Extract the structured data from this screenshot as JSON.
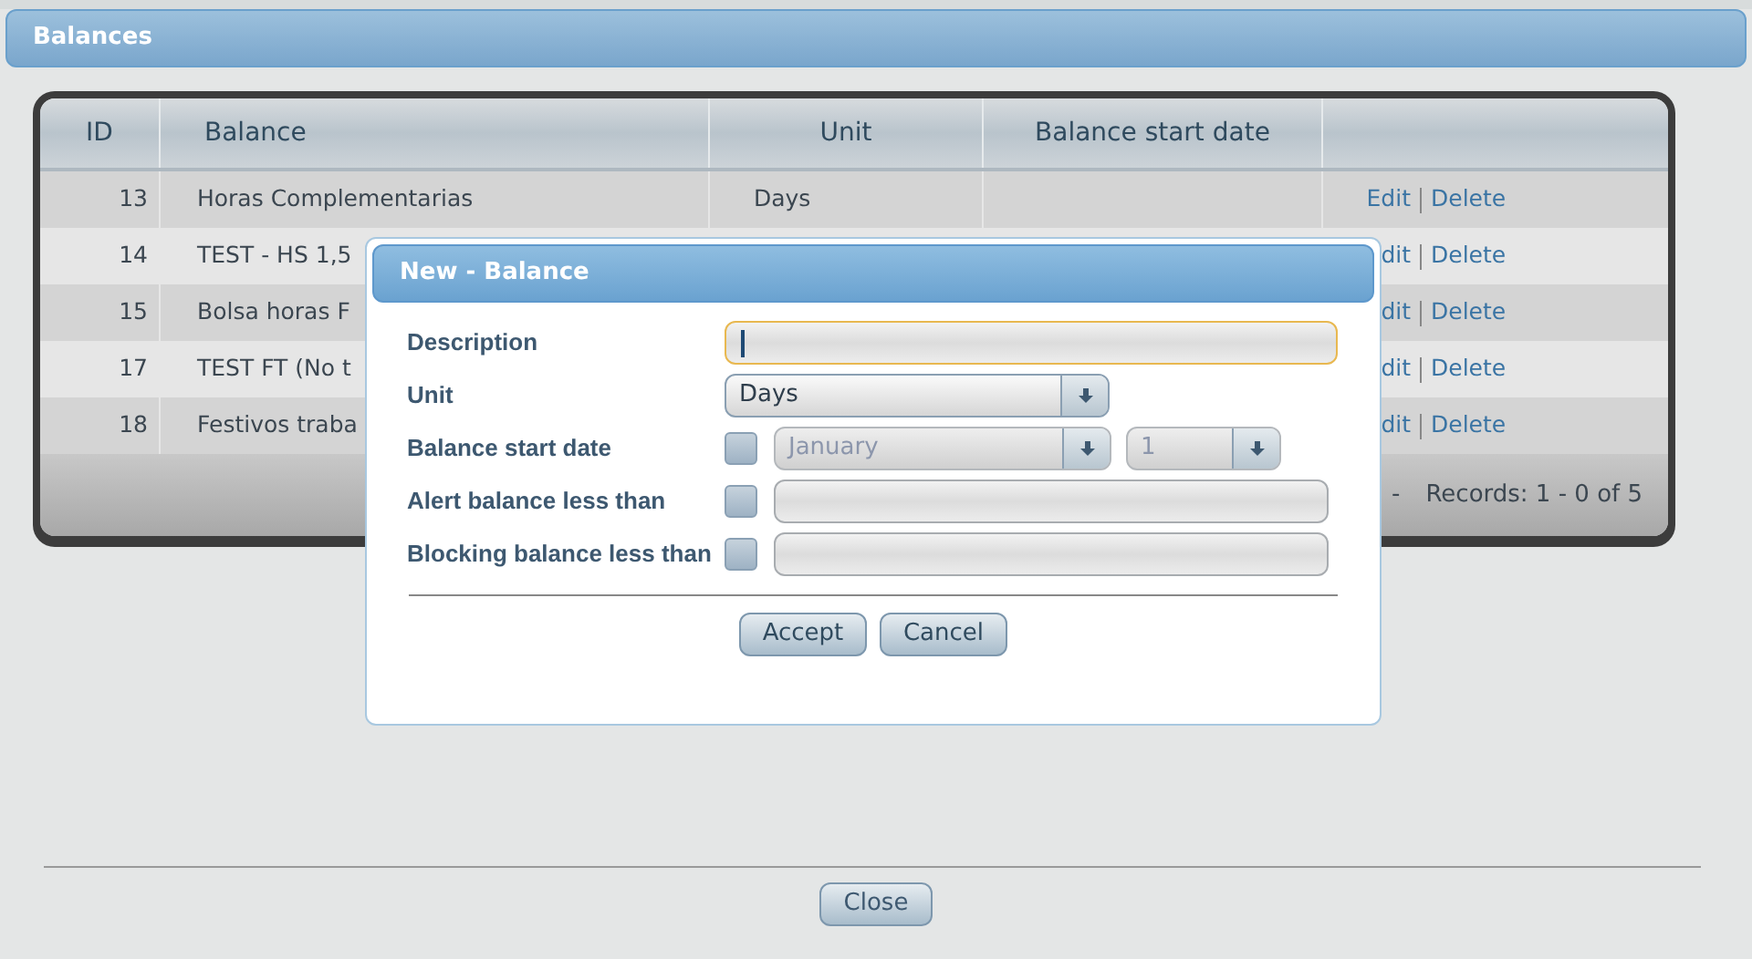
{
  "window": {
    "title": "Balances"
  },
  "table": {
    "columns": [
      "ID",
      "Balance",
      "Unit",
      "Balance start date"
    ],
    "rows": [
      {
        "id": "13",
        "balance": "Horas Complementarias",
        "unit": "Days",
        "start_date": "",
        "edit": "Edit",
        "delete": "Delete"
      },
      {
        "id": "14",
        "balance": "TEST - HS 1,5",
        "unit": "",
        "start_date": "",
        "edit": "dit",
        "delete": "Delete"
      },
      {
        "id": "15",
        "balance": "Bolsa horas F",
        "unit": "",
        "start_date": "",
        "edit": "dit",
        "delete": "Delete"
      },
      {
        "id": "17",
        "balance": "TEST FT (No t",
        "unit": "",
        "start_date": "",
        "edit": "dit",
        "delete": "Delete"
      },
      {
        "id": "18",
        "balance": "Festivos traba",
        "unit": "",
        "start_date": "",
        "edit": "dit",
        "delete": "Delete"
      }
    ],
    "pager_fragment": "-",
    "records": "Records: 1 - 0 of 5"
  },
  "dialog": {
    "title": "New - Balance",
    "description": {
      "label": "Description",
      "focused": true
    },
    "unit": {
      "label": "Unit",
      "value": "Days"
    },
    "start_date": {
      "label": "Balance start date",
      "checked": false,
      "month": "January",
      "day": "1",
      "disabled": true
    },
    "alert": {
      "label": "Alert balance less than",
      "checked": false
    },
    "blocking": {
      "label": "Blocking balance less than",
      "checked": false
    },
    "buttons": [
      "Accept",
      "Cancel"
    ]
  },
  "close_button": "Close"
}
